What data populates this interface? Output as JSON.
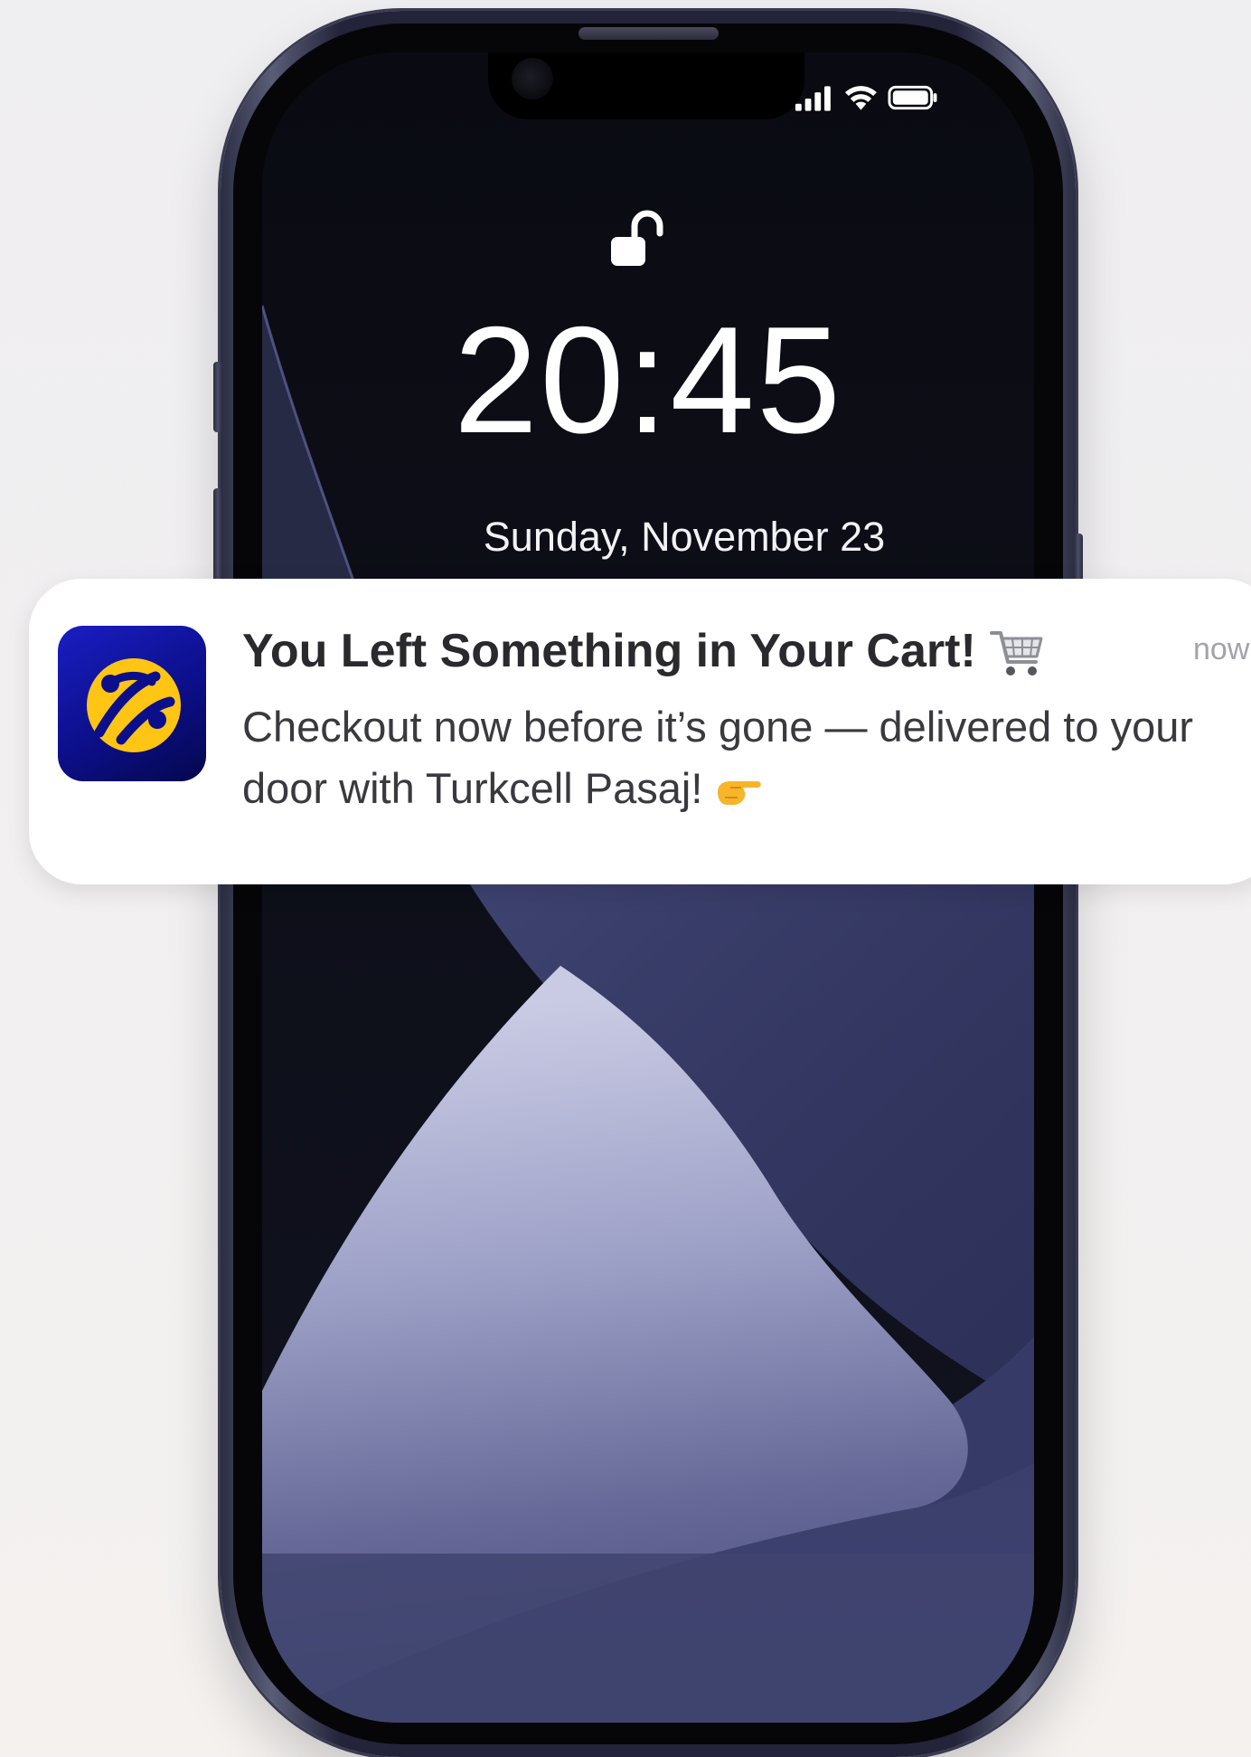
{
  "lock_screen": {
    "time": "20:45",
    "date": "Sunday, November 23",
    "status_icons": [
      "cellular-signal-icon",
      "wifi-icon",
      "battery-icon"
    ],
    "lock_icon": "unlocked-padlock-icon"
  },
  "notification": {
    "app_icon": "turkcell-logo-icon",
    "title": "You Left Something in Your Cart!",
    "title_emoji": "shopping-cart-icon",
    "timestamp": "now",
    "body": "Checkout now before it’s gone — delivered to your door with Turkcell Pasaj!",
    "body_emoji": "pointing-hand-icon"
  },
  "colors": {
    "brand_blue": "#0c0f8a",
    "brand_yellow": "#ffc515",
    "notification_bg": "#ffffff",
    "title_text": "#2a2a2e",
    "body_text": "#3a3a3e",
    "timestamp_text": "#a3a3a8"
  }
}
